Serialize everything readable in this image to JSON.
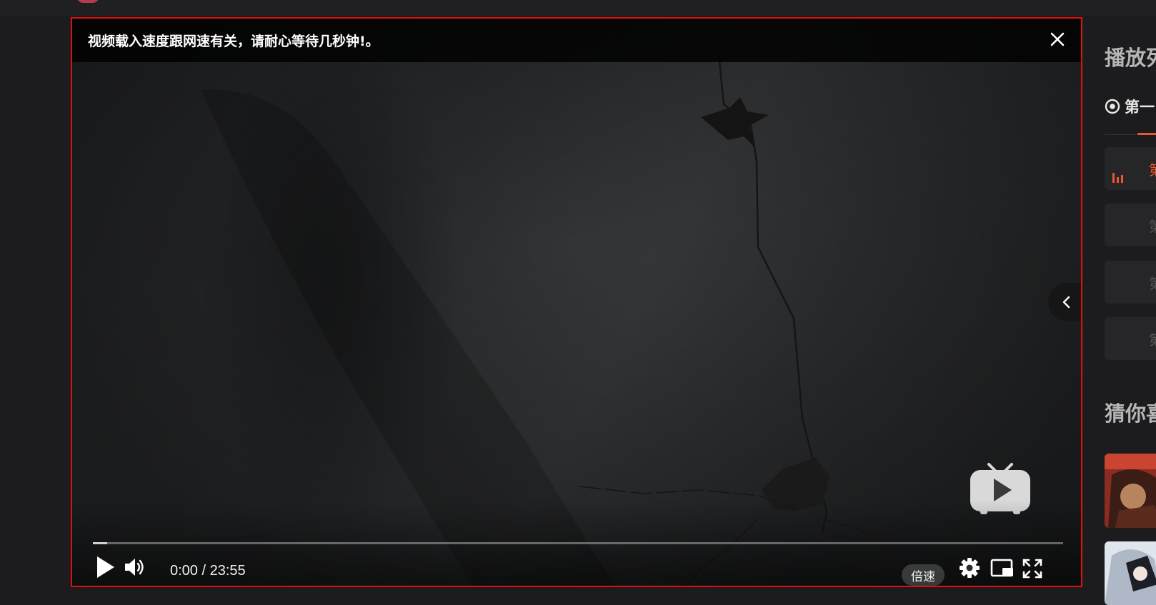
{
  "player": {
    "notice": "视频载入速度跟网速有关，请耐心等待几秒钟!。",
    "time_current": "0:00",
    "time_separator": " / ",
    "time_total": "23:55",
    "speed_label": "倍速",
    "progress_buffered_fraction": 0.015
  },
  "sidebar": {
    "title": "播放列",
    "tab_label": "第一",
    "episodes": [
      {
        "label": "第",
        "active": true
      },
      {
        "label": "第",
        "active": false
      },
      {
        "label": "第",
        "active": false
      },
      {
        "label": "第",
        "active": false
      }
    ],
    "guess_title": "猜你喜"
  },
  "colors": {
    "accent": "#e8582e",
    "highlight_border": "#e01010"
  },
  "icons": [
    "close-icon",
    "chevron-left-icon",
    "bilibili-tv-icon",
    "play-icon",
    "volume-icon",
    "settings-icon",
    "picture-in-picture-icon",
    "fullscreen-icon",
    "play-circle-icon",
    "bars-icon"
  ]
}
